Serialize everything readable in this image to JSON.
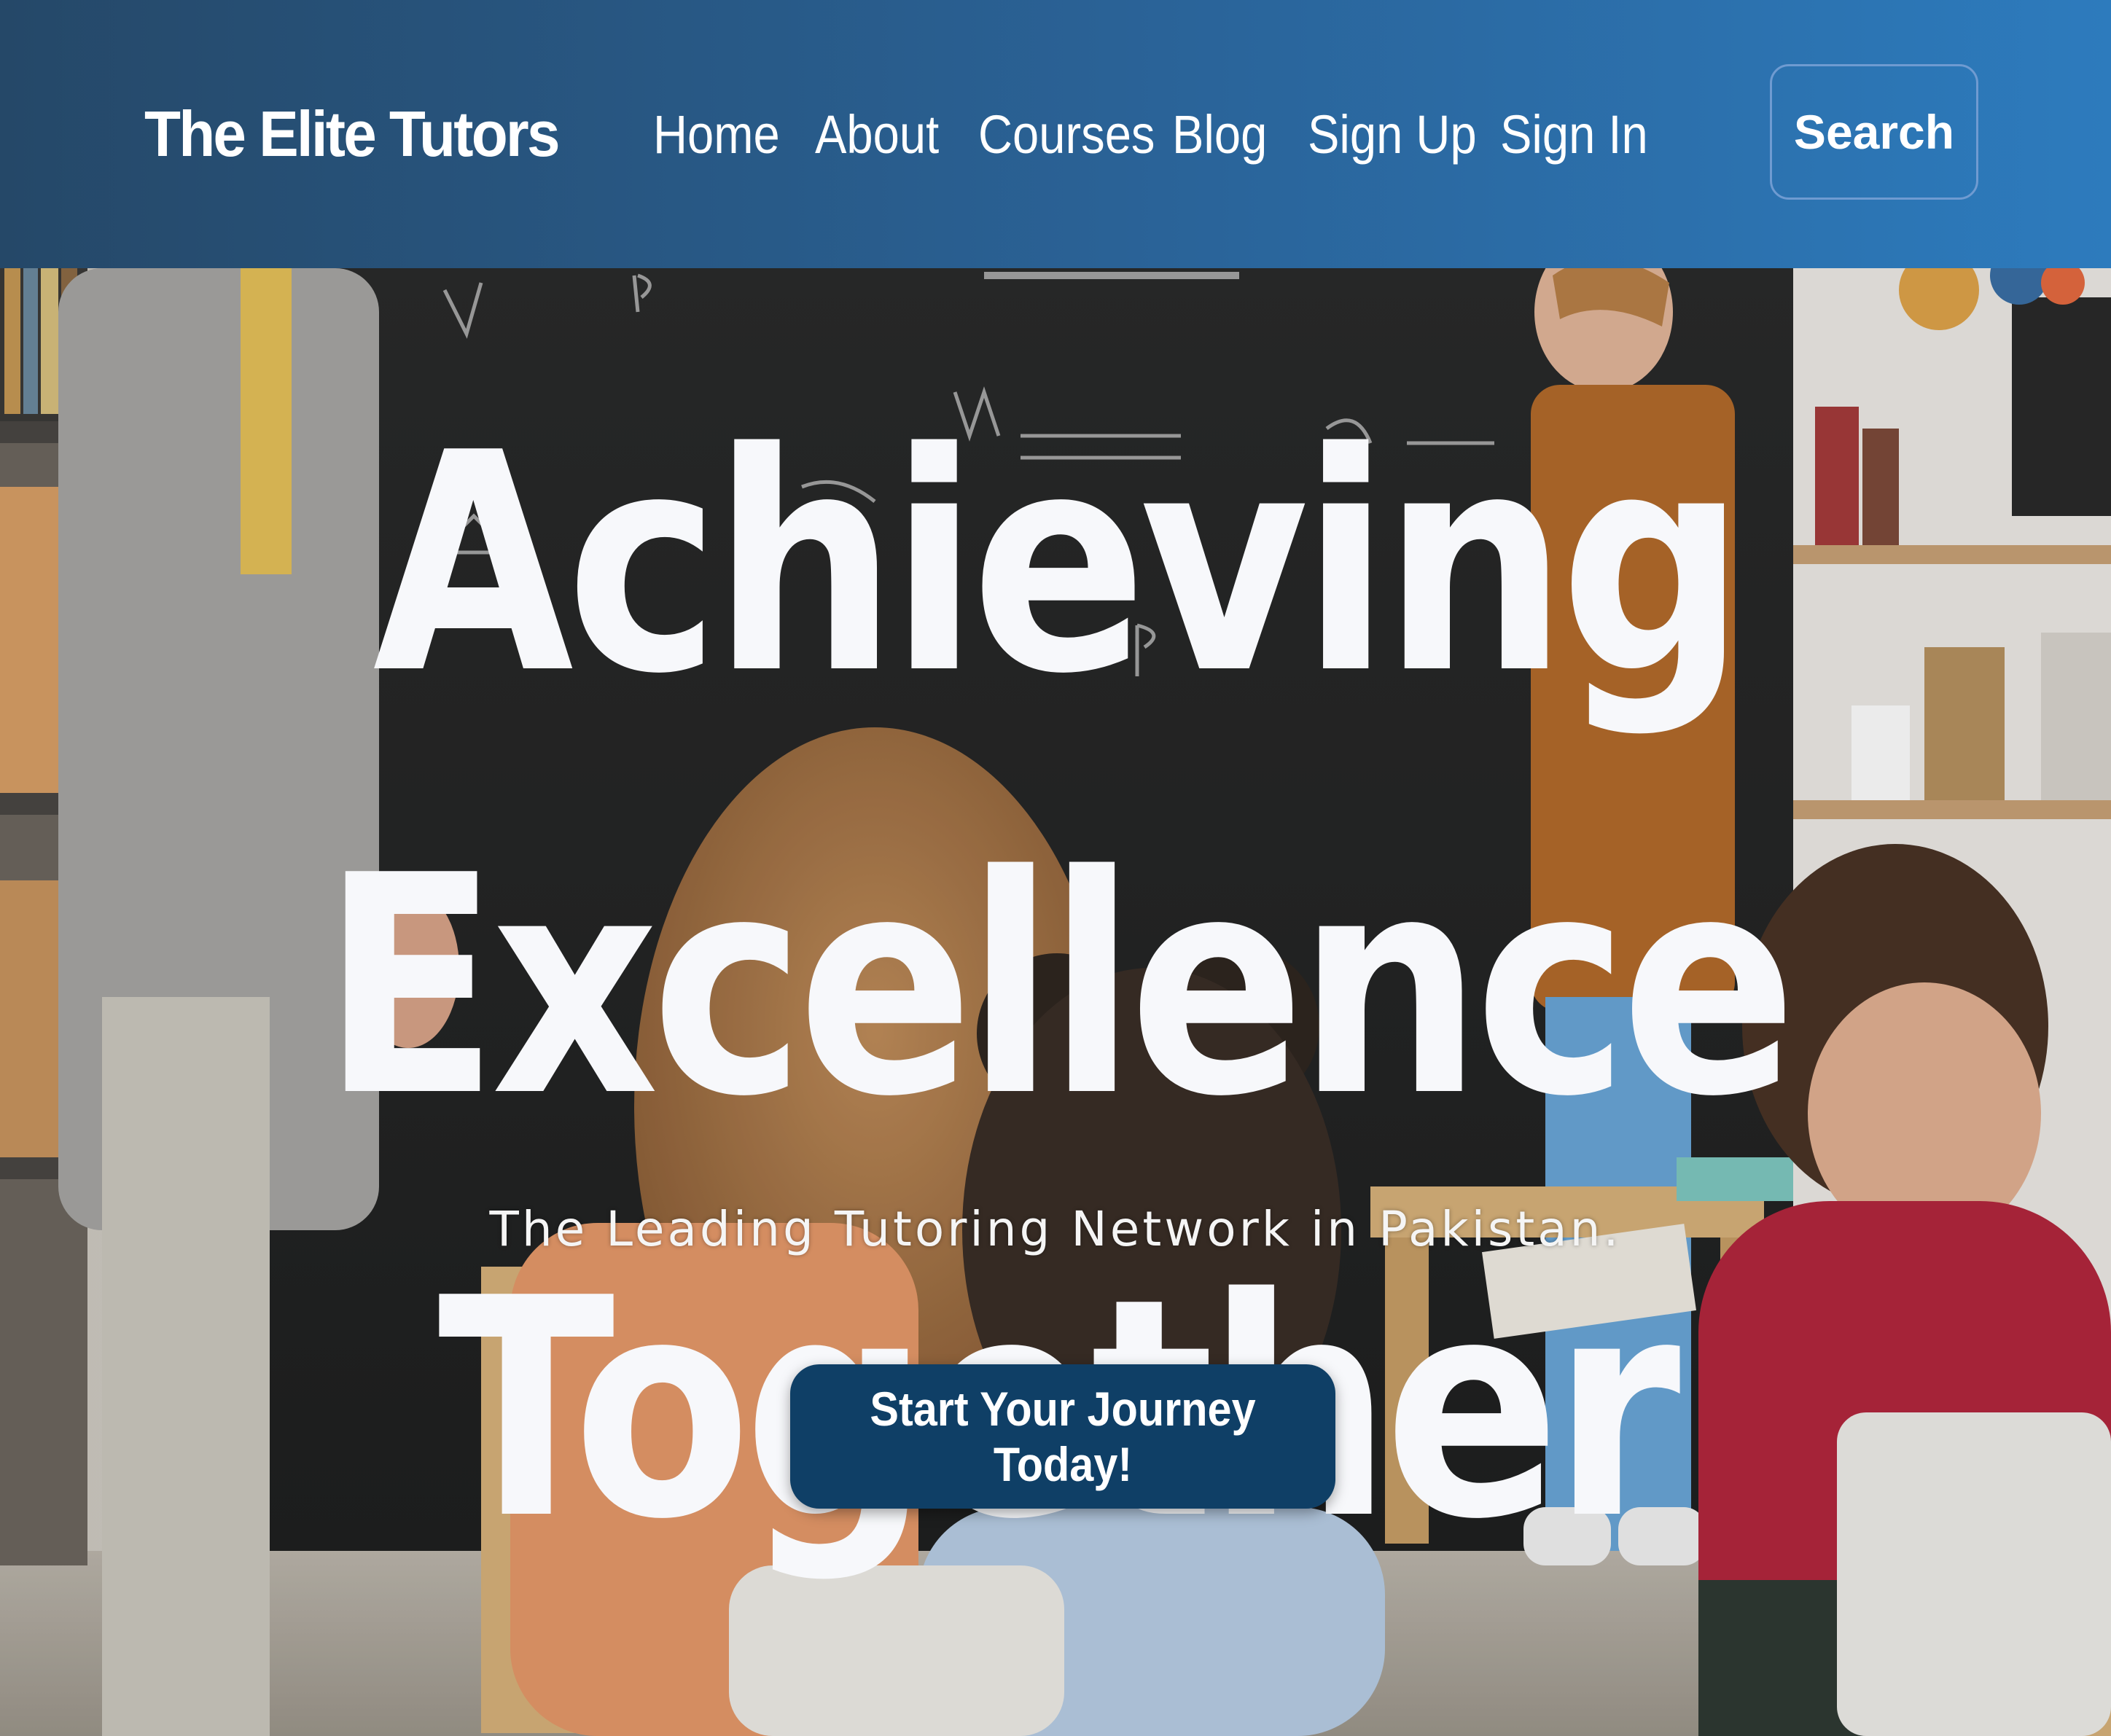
{
  "navbar": {
    "brand": "The Elite Tutors",
    "links": [
      {
        "label": "Home"
      },
      {
        "label": "About"
      },
      {
        "label": "Courses"
      },
      {
        "label": "Blog"
      },
      {
        "label": "Sign Up"
      },
      {
        "label": "Sign In"
      }
    ],
    "search_label": "Search"
  },
  "hero": {
    "title_line_1": "Achieving Excellence",
    "title_line_2": "Together",
    "subtitle": "The Leading Tutoring Network in Pakistan.",
    "cta_label": "Start Your Journey Today!",
    "image_description_icon": "classroom-photo"
  },
  "colors": {
    "navbar_start": "#254868",
    "navbar_end": "#2d7bbd",
    "cta_background": "#0f3f66",
    "hero_text": "#f7f8fb"
  }
}
